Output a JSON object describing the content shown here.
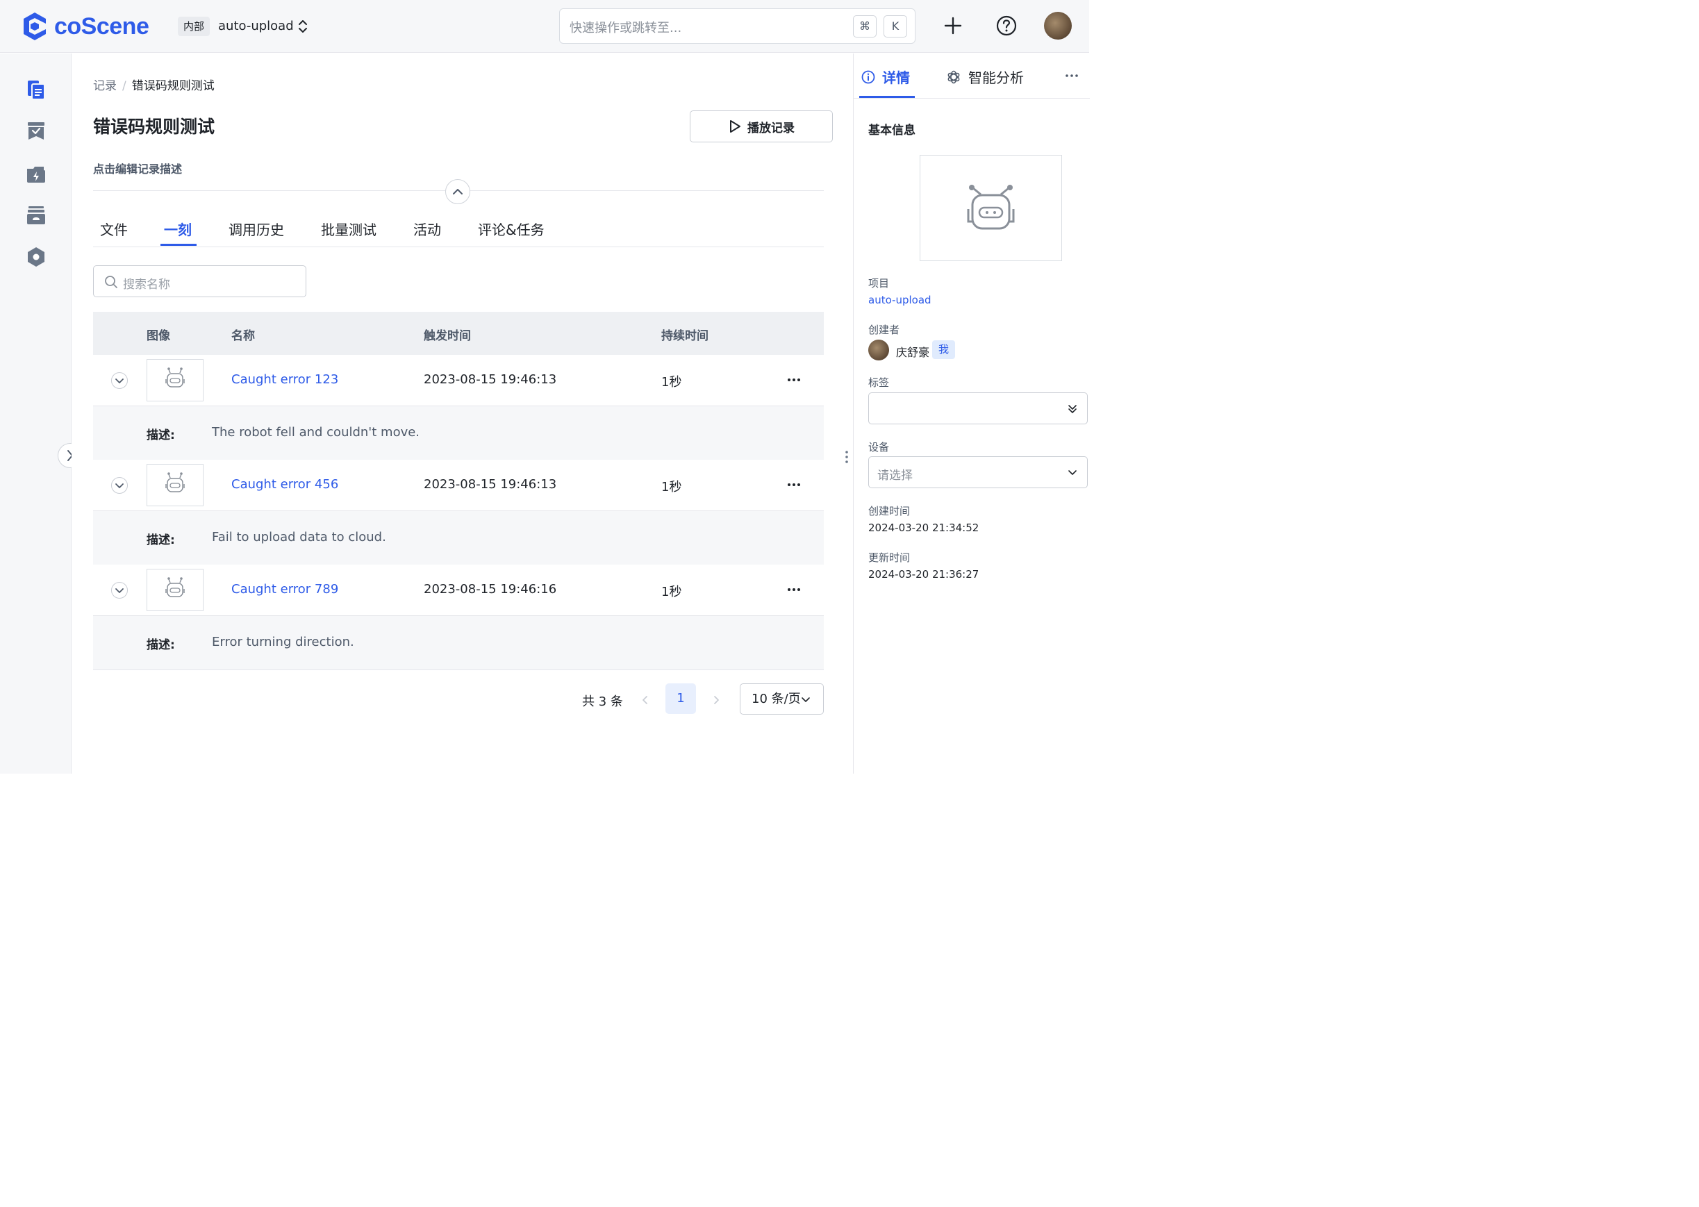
{
  "header": {
    "logo_text": "coScene",
    "project_badge": "内部",
    "project_name": "auto-upload",
    "search_placeholder": "快速操作或跳转至...",
    "kbd_cmd": "⌘",
    "kbd_k": "K",
    "icons": [
      "plus-icon",
      "help-icon"
    ],
    "accent_color": "#2e5be8"
  },
  "rail": {
    "items": [
      "records-icon",
      "tasks-icon",
      "actions-icon",
      "storage-icon",
      "settings-hex-icon"
    ]
  },
  "breadcrumb": {
    "root": "记录",
    "separator": "/",
    "current": "错误码规则测试"
  },
  "record": {
    "title": "错误码规则测试",
    "play_button": "播放记录",
    "description_placeholder": "点击编辑记录描述"
  },
  "tabs": [
    {
      "label": "文件",
      "active": false
    },
    {
      "label": "一刻",
      "active": true
    },
    {
      "label": "调用历史",
      "active": false
    },
    {
      "label": "批量测试",
      "active": false
    },
    {
      "label": "活动",
      "active": false
    },
    {
      "label": "评论&任务",
      "active": false
    }
  ],
  "moment_search": {
    "placeholder": "搜索名称"
  },
  "table": {
    "columns": [
      "图像",
      "名称",
      "触发时间",
      "持续时间"
    ],
    "desc_label": "描述:",
    "rows": [
      {
        "name": "Caught error 123",
        "trigger_time": "2023-08-15 19:46:13",
        "duration": "1秒",
        "description": "The robot fell and couldn't move."
      },
      {
        "name": "Caught error 456",
        "trigger_time": "2023-08-15 19:46:13",
        "duration": "1秒",
        "description": "Fail to upload data to cloud."
      },
      {
        "name": "Caught error 789",
        "trigger_time": "2023-08-15 19:46:16",
        "duration": "1秒",
        "description": "Error turning direction."
      }
    ]
  },
  "pagination": {
    "total": "共 3 条",
    "current_page": "1",
    "page_size": "10 条/页"
  },
  "right_panel": {
    "tabs": [
      {
        "label": "详情",
        "active": true,
        "icon": "info-icon"
      },
      {
        "label": "智能分析",
        "active": false,
        "icon": "ai-swirl-icon"
      }
    ],
    "section_title": "基本信息",
    "fields": {
      "project_label": "项目",
      "project_value": "auto-upload",
      "creator_label": "创建者",
      "creator_name": "庆舒豪",
      "creator_badge": "我",
      "tags_label": "标签",
      "device_label": "设备",
      "device_placeholder": "请选择",
      "created_label": "创建时间",
      "created_value": "2024-03-20 21:34:52",
      "updated_label": "更新时间",
      "updated_value": "2024-03-20 21:36:27"
    }
  }
}
